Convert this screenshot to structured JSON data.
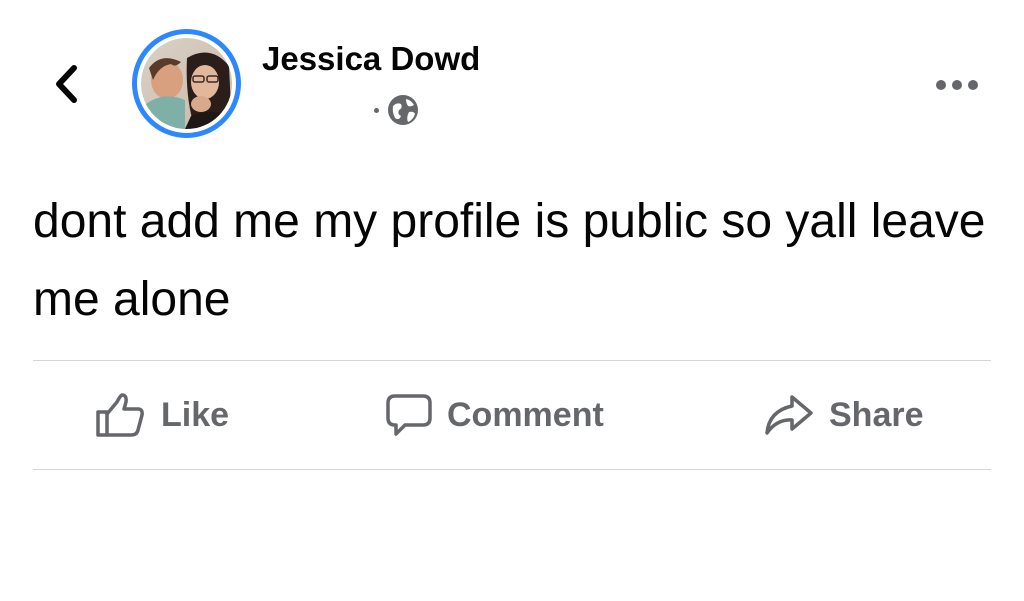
{
  "post": {
    "author": {
      "name": "Jessica Dowd"
    },
    "meta": {
      "separator": "·",
      "audience_icon": "globe-icon"
    },
    "text": "dont add me my profile is public so yall leave me alone"
  },
  "header": {
    "back_icon": "chevron-left-icon",
    "more_icon": "more-horizontal-icon"
  },
  "actions": [
    {
      "label": "Like",
      "icon": "thumbs-up-icon"
    },
    {
      "label": "Comment",
      "icon": "comment-icon"
    },
    {
      "label": "Share",
      "icon": "share-icon"
    }
  ],
  "colors": {
    "story_ring": "#2d88ff",
    "secondary_text": "#65676b",
    "primary_text": "#050505",
    "divider": "#d3d5d9"
  }
}
